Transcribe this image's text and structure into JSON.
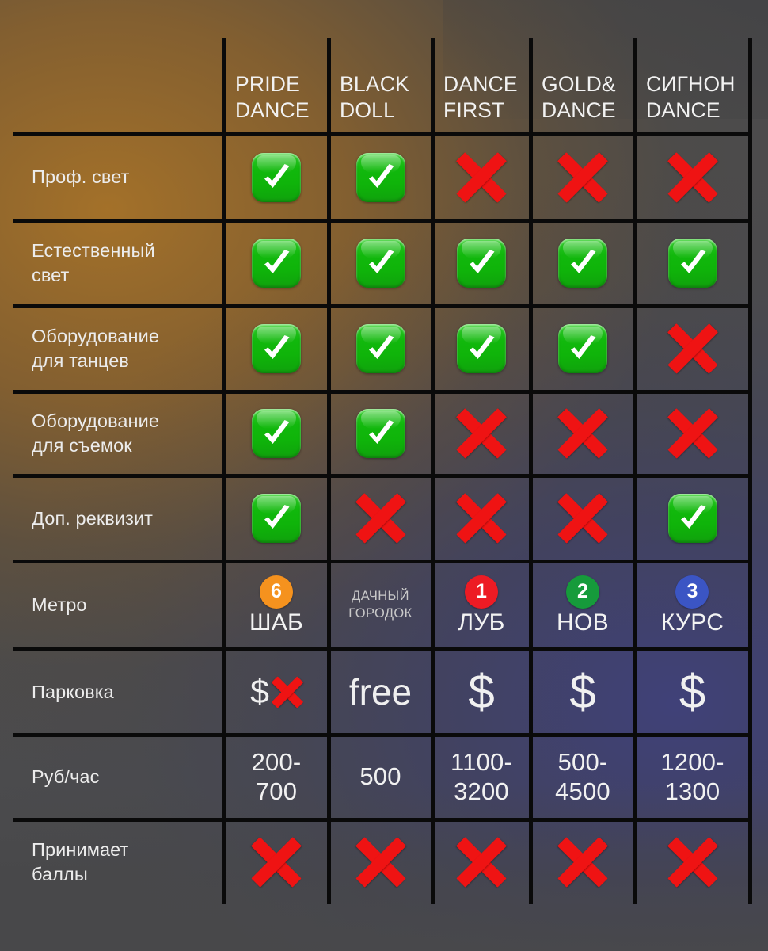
{
  "table": {
    "row_label_header": "",
    "columns": [
      {
        "name": "pride-dance",
        "label": "PRIDE\nDANCE"
      },
      {
        "name": "black-doll",
        "label": "BLACK\nDOLL"
      },
      {
        "name": "dance-first",
        "label": "DANCE\nFIRST"
      },
      {
        "name": "gold-dance",
        "label": "GOLD&\nDANCE"
      },
      {
        "name": "signon-dance",
        "label": "СИГНОН\nDANCE"
      }
    ],
    "rows": [
      {
        "name": "prof-light",
        "label": "Проф. свет",
        "type": "icons",
        "values": [
          "check",
          "check",
          "cross",
          "cross",
          "cross"
        ]
      },
      {
        "name": "natural-light",
        "label": "Естественный\nсвет",
        "type": "icons",
        "values": [
          "check",
          "check",
          "check",
          "check",
          "check"
        ]
      },
      {
        "name": "dance-equipment",
        "label": "Оборудование\nдля танцев",
        "type": "icons",
        "values": [
          "check",
          "check",
          "check",
          "check",
          "cross"
        ]
      },
      {
        "name": "shooting-equipment",
        "label": "Оборудование\nдля съемок",
        "type": "icons",
        "values": [
          "check",
          "check",
          "cross",
          "cross",
          "cross"
        ]
      },
      {
        "name": "extra-props",
        "label": "Доп. реквизит",
        "type": "icons",
        "values": [
          "check",
          "cross",
          "cross",
          "cross",
          "check"
        ]
      },
      {
        "name": "metro",
        "label": "Метро",
        "type": "metro",
        "values": [
          {
            "line": "6",
            "color": "#F5921E",
            "station": "ШАБ"
          },
          {
            "line": "",
            "color": "",
            "station": "ДАЧНЫЙ\nГОРОДОК",
            "textonly": true
          },
          {
            "line": "1",
            "color": "#ED1B24",
            "station": "ЛУБ"
          },
          {
            "line": "2",
            "color": "#169B3B",
            "station": "НОВ"
          },
          {
            "line": "3",
            "color": "#3B55C4",
            "station": "КУРС"
          }
        ]
      },
      {
        "name": "parking",
        "label": "Парковка",
        "type": "parking",
        "values": [
          {
            "kind": "dollar-cross",
            "text": "$"
          },
          {
            "kind": "free",
            "text": "free"
          },
          {
            "kind": "dollar",
            "text": "$"
          },
          {
            "kind": "dollar",
            "text": "$"
          },
          {
            "kind": "dollar",
            "text": "$"
          }
        ]
      },
      {
        "name": "price-per-hour",
        "label": "Руб/час",
        "type": "text",
        "values": [
          "200-\n700",
          "500",
          "1100-\n3200",
          "500-\n4500",
          "1200-\n1300"
        ]
      },
      {
        "name": "accepts-points",
        "label": "Принимает\nбаллы",
        "type": "icons",
        "values": [
          "cross",
          "cross",
          "cross",
          "cross",
          "cross"
        ]
      }
    ]
  },
  "icons": {
    "check": "green-check-icon",
    "cross": "red-cross-icon"
  },
  "colors": {
    "check_green": "#11B80C",
    "cross_red": "#EF1313",
    "grid_line": "#0A0A0A",
    "text_primary": "#F0F0F0",
    "background_warm": "#AB7426",
    "background_cool": "#3E3F80",
    "background_base": "#4B4B4D"
  }
}
